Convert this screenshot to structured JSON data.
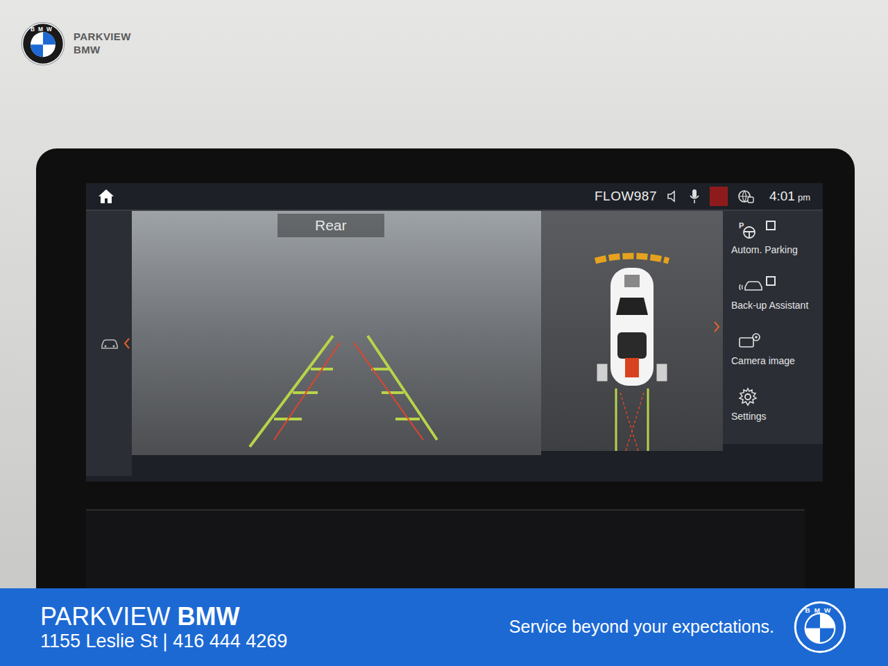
{
  "header": {
    "logo_letters": "BMW",
    "name_top": "PARKVIEW",
    "name_bottom": "BMW"
  },
  "status_bar": {
    "source": "FLOW987",
    "time": "4:01",
    "meridiem": "pm"
  },
  "camera": {
    "label": "Rear"
  },
  "menu": [
    {
      "label": "Autom. Parking",
      "kind": "checkbox",
      "checked": false
    },
    {
      "label": "Back-up Assistant",
      "kind": "checkbox",
      "checked": false
    },
    {
      "label": "Camera image",
      "kind": "button"
    },
    {
      "label": "Settings",
      "kind": "button"
    }
  ],
  "footer": {
    "name_light": "PARKVIEW",
    "name_bold": "BMW",
    "address": "1155 Leslie St | 416 444 4269",
    "slogan": "Service beyond your expectations.",
    "logo_letters": "BMW"
  }
}
